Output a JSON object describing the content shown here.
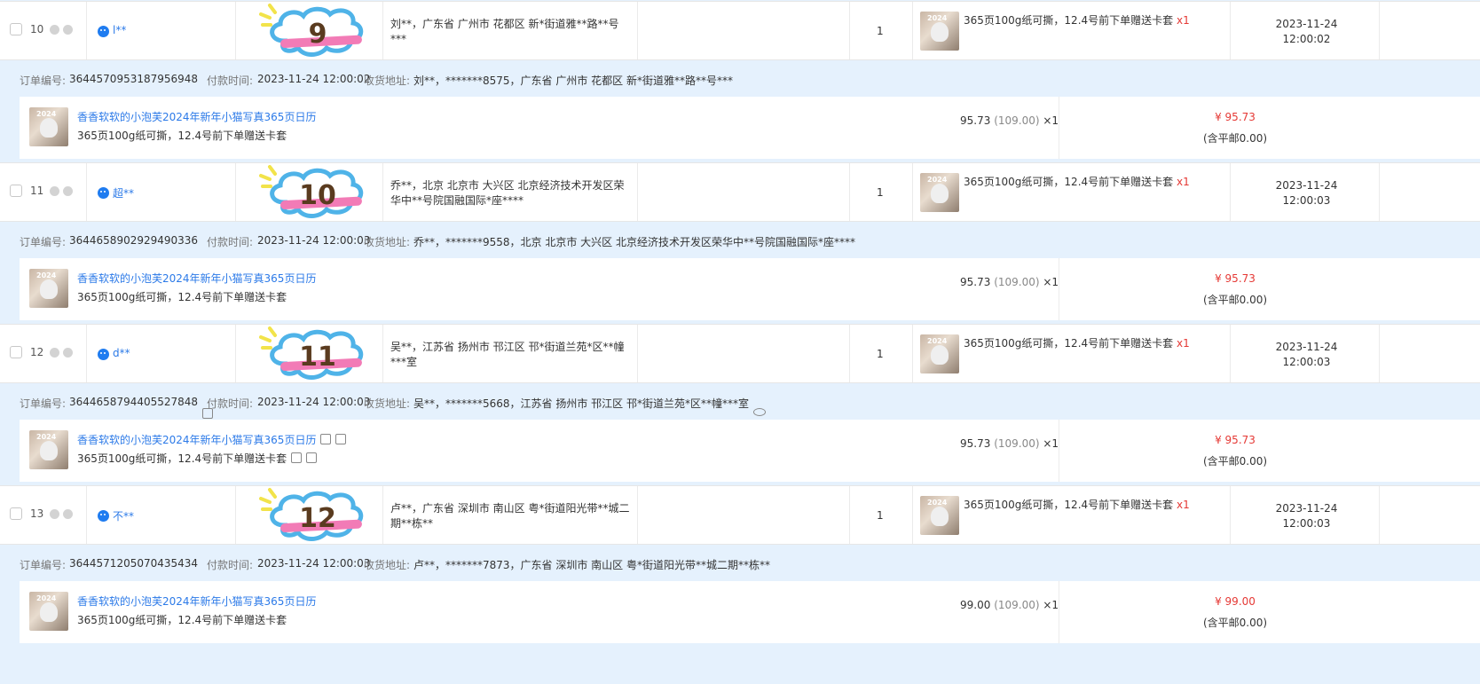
{
  "orders": [
    {
      "index": "10",
      "buyer": "l**",
      "badge_number": "9",
      "address_short": "刘**，广东省 广州市 花都区 新*街道雅**路**号***",
      "quantity": "1",
      "sku_text": "365页100g纸可撕，12.4号前下单赠送卡套",
      "sku_qty": "x1",
      "date": "2023-11-24",
      "time": "12:00:02",
      "order_no_label": "订单编号:",
      "order_no": "3644570953187956948",
      "pay_label": "付款时间:",
      "pay_time": "2023-11-24 12:00:02",
      "ship_label": "收货地址:",
      "ship_addr": "刘**，*******8575，广东省 广州市 花都区 新*街道雅**路**号***",
      "product_title": "香香软软的小泡芙2024年新年小猫写真365页日历",
      "product_spec": "365页100g纸可撕，12.4号前下单赠送卡套",
      "unit_price": "95.73",
      "orig_price": "(109.00)",
      "unit_qty": "×1",
      "total": "¥ 95.73",
      "shipping": "(含平邮0.00)"
    },
    {
      "index": "11",
      "buyer": "超**",
      "badge_number": "10",
      "address_short": "乔**，北京 北京市 大兴区 北京经济技术开发区荣华中**号院国融国际*座****",
      "quantity": "1",
      "sku_text": "365页100g纸可撕，12.4号前下单赠送卡套",
      "sku_qty": "x1",
      "date": "2023-11-24",
      "time": "12:00:03",
      "order_no_label": "订单编号:",
      "order_no": "3644658902929490336",
      "pay_label": "付款时间:",
      "pay_time": "2023-11-24 12:00:03",
      "ship_label": "收货地址:",
      "ship_addr": "乔**，*******9558，北京 北京市 大兴区 北京经济技术开发区荣华中**号院国融国际*座****",
      "product_title": "香香软软的小泡芙2024年新年小猫写真365页日历",
      "product_spec": "365页100g纸可撕，12.4号前下单赠送卡套",
      "unit_price": "95.73",
      "orig_price": "(109.00)",
      "unit_qty": "×1",
      "total": "¥ 95.73",
      "shipping": "(含平邮0.00)"
    },
    {
      "index": "12",
      "buyer": "d**",
      "badge_number": "11",
      "address_short": "吴**，江苏省 扬州市 邗江区 邗*街道兰苑*区**幢***室",
      "quantity": "1",
      "sku_text": "365页100g纸可撕，12.4号前下单赠送卡套",
      "sku_qty": "x1",
      "date": "2023-11-24",
      "time": "12:00:03",
      "order_no_label": "订单编号:",
      "order_no": "3644658794405527848",
      "pay_label": "付款时间:",
      "pay_time": "2023-11-24 12:00:03",
      "ship_label": "收货地址:",
      "ship_addr": "吴**，*******5668，江苏省 扬州市 邗江区 邗*街道兰苑*区**幢***室",
      "product_title": "香香软软的小泡芙2024年新年小猫写真365页日历",
      "product_spec": "365页100g纸可撕，12.4号前下单赠送卡套",
      "unit_price": "95.73",
      "orig_price": "(109.00)",
      "unit_qty": "×1",
      "total": "¥ 95.73",
      "shipping": "(含平邮0.00)"
    },
    {
      "index": "13",
      "buyer": "不**",
      "badge_number": "12",
      "address_short": "卢**，广东省 深圳市 南山区 粤*街道阳光带**城二期**栋**",
      "quantity": "1",
      "sku_text": "365页100g纸可撕，12.4号前下单赠送卡套",
      "sku_qty": "x1",
      "date": "2023-11-24",
      "time": "12:00:03",
      "order_no_label": "订单编号:",
      "order_no": "3644571205070435434",
      "pay_label": "付款时间:",
      "pay_time": "2023-11-24 12:00:03",
      "ship_label": "收货地址:",
      "ship_addr": "卢**，*******7873，广东省 深圳市 南山区 粤*街道阳光带**城二期**栋**",
      "product_title": "香香软软的小泡芙2024年新年小猫写真365页日历",
      "product_spec": "365页100g纸可撕，12.4号前下单赠送卡套",
      "unit_price": "99.00",
      "orig_price": "(109.00)",
      "unit_qty": "×1",
      "total": "¥ 99.00",
      "shipping": "(含平邮0.00)"
    }
  ],
  "thumb_label": "2024",
  "colors": {
    "link": "#2c7ae8",
    "price": "#e53935",
    "info_bg": "#e5f1fd",
    "badge_outline": "#4fb3e8",
    "badge_stripe": "#f27bb6"
  }
}
